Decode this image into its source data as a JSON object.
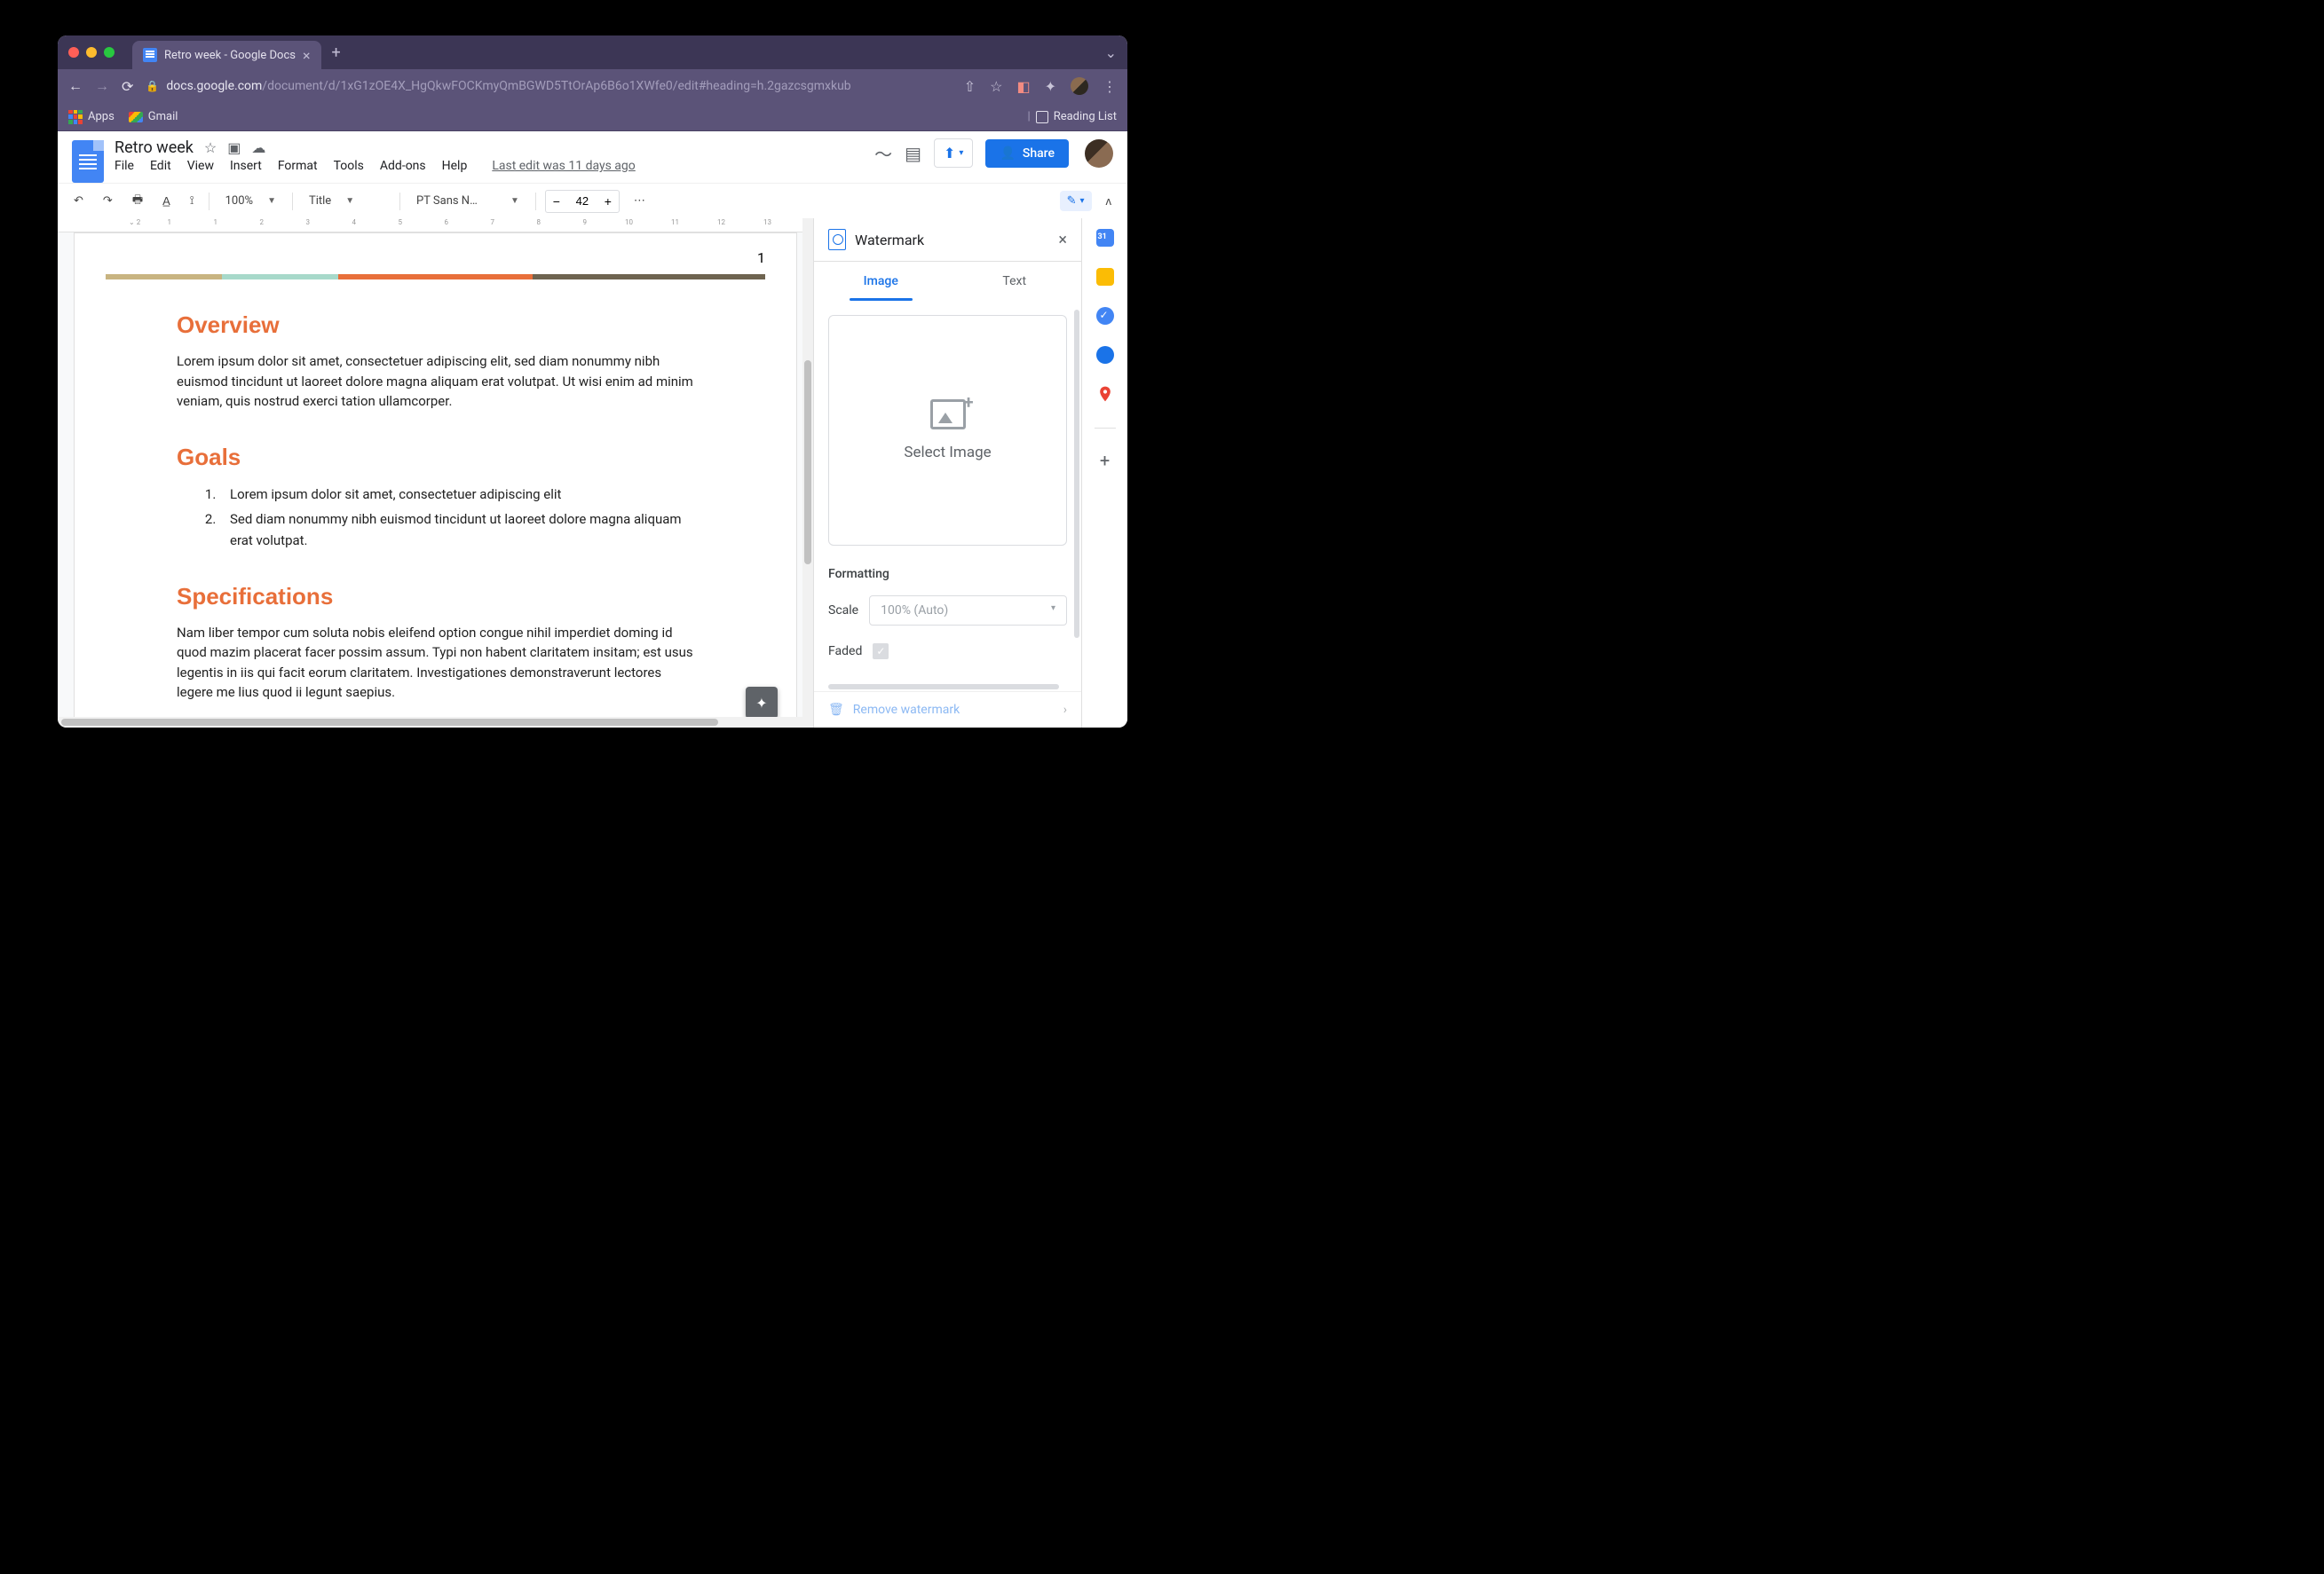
{
  "browser": {
    "tab_title": "Retro week - Google Docs",
    "url_host": "docs.google.com",
    "url_path": "/document/d/1xG1zOE4X_HgQkwFOCKmyQmBGWD5TtOrAp6B6o1XWfe0/edit#heading=h.2gazcsgmxkub",
    "bookmarks": {
      "apps": "Apps",
      "gmail": "Gmail",
      "reading_list": "Reading List"
    }
  },
  "docs": {
    "title": "Retro week",
    "menus": [
      "File",
      "Edit",
      "View",
      "Insert",
      "Format",
      "Tools",
      "Add-ons",
      "Help"
    ],
    "last_edit": "Last edit was 11 days ago",
    "share": "Share"
  },
  "toolbar": {
    "zoom": "100%",
    "style": "Title",
    "font": "PT Sans N…",
    "size": "42"
  },
  "document": {
    "page_number": "1",
    "h_overview": "Overview",
    "p_overview": "Lorem ipsum dolor sit amet, consectetuer adipiscing elit, sed diam nonummy nibh euismod tincidunt ut laoreet dolore magna aliquam erat volutpat. Ut wisi enim ad minim veniam, quis nostrud exerci tation ullamcorper.",
    "h_goals": "Goals",
    "goals": [
      "Lorem ipsum dolor sit amet, consectetuer adipiscing elit",
      "Sed diam nonummy nibh euismod tincidunt ut laoreet dolore magna aliquam erat volutpat."
    ],
    "h_specs": "Specifications",
    "p_specs": "Nam liber tempor cum soluta nobis eleifend option congue nihil imperdiet doming id quod mazim placerat facer possim assum. Typi non habent claritatem insitam; est usus legentis in iis qui facit eorum claritatem. Investigationes demonstraverunt lectores legere me lius quod ii legunt saepius."
  },
  "panel": {
    "title": "Watermark",
    "tab_image": "Image",
    "tab_text": "Text",
    "select_image": "Select Image",
    "formatting": "Formatting",
    "scale_label": "Scale",
    "scale_value": "100% (Auto)",
    "faded_label": "Faded",
    "remove": "Remove watermark"
  }
}
